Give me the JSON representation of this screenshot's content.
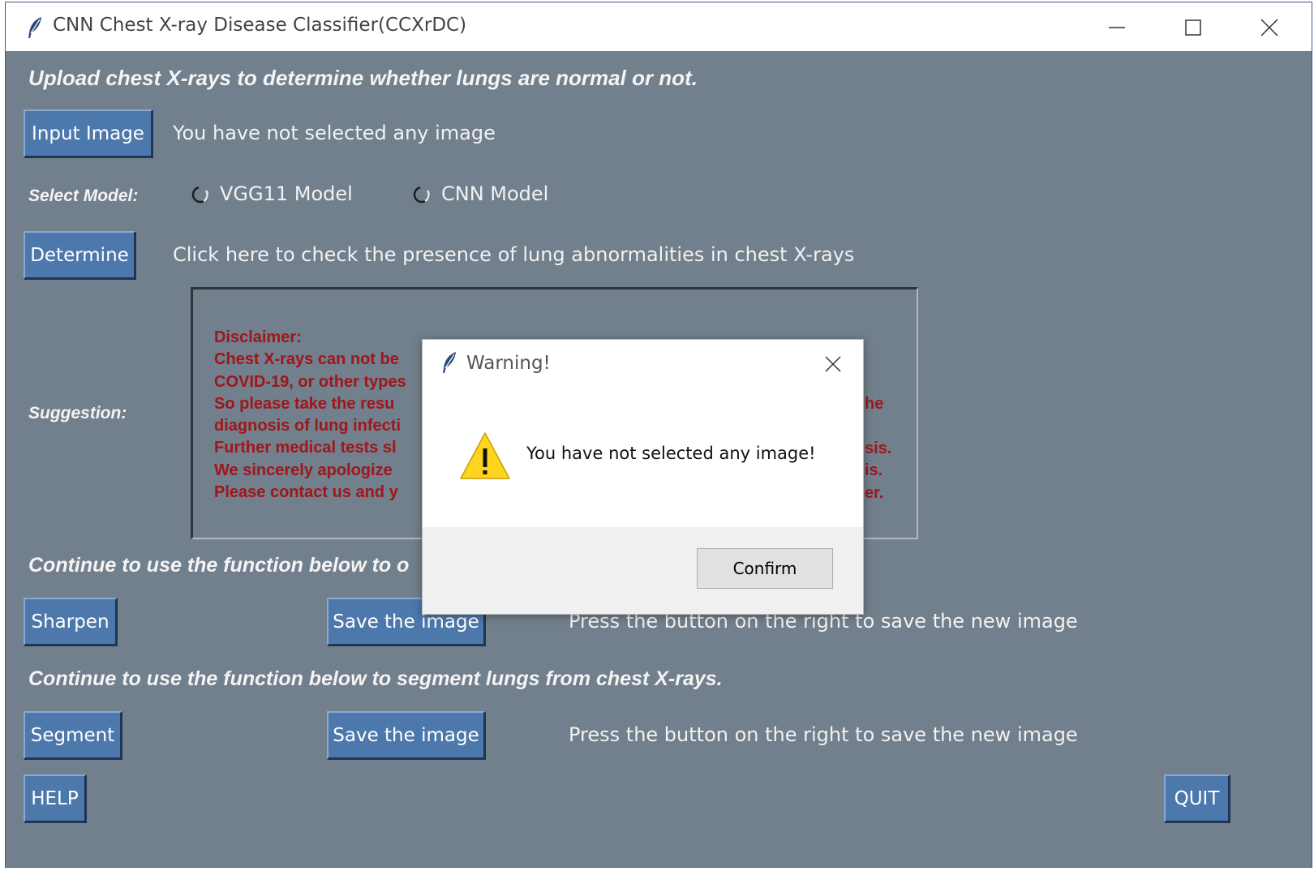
{
  "window": {
    "title": "CNN Chest X-ray Disease Classifier(CCXrDC)"
  },
  "main": {
    "heading": "Upload chest X-rays to determine whether lungs are normal or not.",
    "input_button": "Input Image",
    "input_status": "You have not selected any image",
    "select_model_label": "Select Model:",
    "model_options": [
      "VGG11 Model",
      "CNN Model"
    ],
    "determine_button": "Determine",
    "determine_hint": "Click here to check the presence of lung abnormalities in chest X-rays",
    "suggestion_label": "Suggestion:",
    "disclaimer": [
      "Disclaimer:",
      "Chest X-rays can not be",
      "COVID-19, or other types",
      "So please take the resu",
      "diagnosis of lung infecti",
      "Further medical tests sl",
      "We sincerely apologize",
      "Please contact us and y"
    ],
    "disclaimer_right_fragments": [
      "he",
      "sis.",
      "is.",
      "er."
    ],
    "section_sharpen": "Continue to use the function below to o",
    "sharpen_button": "Sharpen",
    "save_button_1": "Save the image",
    "save_hint_1": "Press the button on the right to save the new image",
    "section_segment": "Continue to use the function below to segment lungs from chest X-rays.",
    "segment_button": "Segment",
    "save_button_2": "Save the image",
    "save_hint_2": "Press the button on the right to save the new image",
    "help_button": "HELP",
    "quit_button": "QUIT"
  },
  "dialog": {
    "title": "Warning!",
    "message": "You have not selected any image!",
    "confirm_button": "Confirm"
  },
  "icons": {
    "app": "feather-icon",
    "warning": "warning-triangle-icon",
    "minimize": "minimize-icon",
    "maximize": "maximize-icon",
    "close": "close-icon"
  },
  "colors": {
    "client_bg": "#727f8c",
    "button_bg": "#4c78ac",
    "disclaimer_text": "#a0161a",
    "warning_yellow": "#ffd41c"
  }
}
